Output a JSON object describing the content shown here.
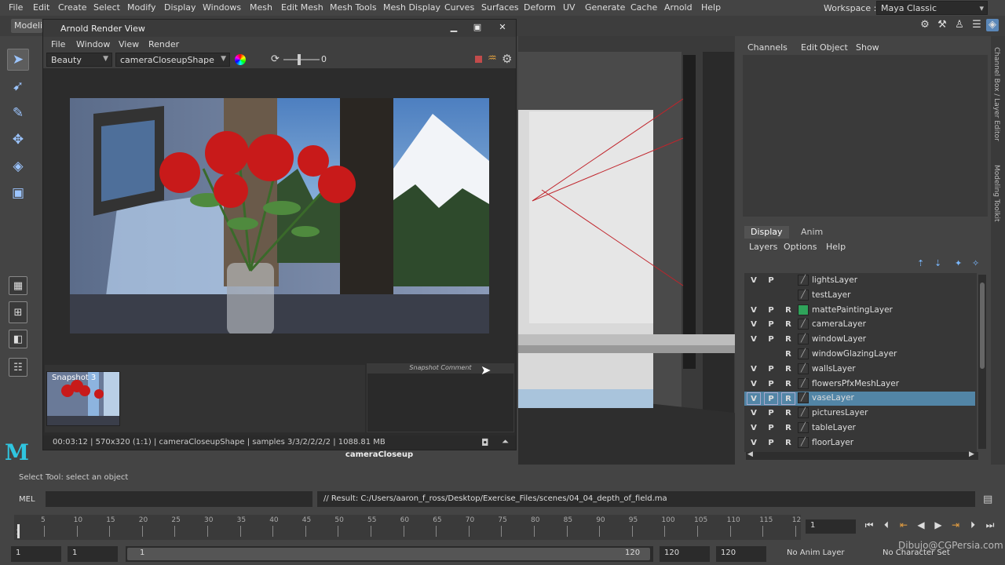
{
  "menubar": {
    "items": [
      "File",
      "Edit",
      "Create",
      "Select",
      "Modify",
      "Display",
      "Windows",
      "Mesh",
      "Edit Mesh",
      "Mesh Tools",
      "Mesh Display",
      "Curves",
      "Surfaces",
      "Deform",
      "UV",
      "Generate",
      "Cache",
      "Arnold",
      "Help"
    ],
    "workspace_label": "Workspace :",
    "workspace_value": "Maya Classic"
  },
  "shelf": {
    "tab": "Modeling"
  },
  "render_view": {
    "title": "Arnold Render View",
    "menu": [
      "File",
      "Window",
      "View",
      "Render"
    ],
    "aov": "Beauty",
    "camera": "cameraCloseupShape",
    "exposure": "0",
    "snapshot_label": "Snapshot 3",
    "snapshot_comment": "Snapshot Comment",
    "status": "00:03:12 | 570x320 (1:1) | cameraCloseupShape  | samples 3/3/2/2/2/2 | 1088.81 MB"
  },
  "viewport": {
    "camera_label": "cameraCloseup"
  },
  "channel_box": {
    "menu": [
      "Channels",
      "Edit",
      "Object",
      "Show"
    ]
  },
  "layer_editor": {
    "tabs": [
      "Display",
      "Anim"
    ],
    "menu": [
      "Layers",
      "Options",
      "Help"
    ],
    "layers": [
      {
        "name": "lightsLayer",
        "v": "V",
        "p": "P",
        "r": ""
      },
      {
        "name": "testLayer",
        "v": "",
        "p": "",
        "r": ""
      },
      {
        "name": "mattePaintingLayer",
        "v": "V",
        "p": "P",
        "r": "R"
      },
      {
        "name": "cameraLayer",
        "v": "V",
        "p": "P",
        "r": "R"
      },
      {
        "name": "windowLayer",
        "v": "V",
        "p": "P",
        "r": "R"
      },
      {
        "name": "windowGlazingLayer",
        "v": "",
        "p": "",
        "r": "R"
      },
      {
        "name": "wallsLayer",
        "v": "V",
        "p": "P",
        "r": "R"
      },
      {
        "name": "flowersPfxMeshLayer",
        "v": "V",
        "p": "P",
        "r": "R"
      },
      {
        "name": "vaseLayer",
        "v": "V",
        "p": "P",
        "r": "R"
      },
      {
        "name": "picturesLayer",
        "v": "V",
        "p": "P",
        "r": "R"
      },
      {
        "name": "tableLayer",
        "v": "V",
        "p": "P",
        "r": "R"
      },
      {
        "name": "floorLayer",
        "v": "V",
        "p": "P",
        "r": "R"
      }
    ],
    "selected_layer": "vaseLayer",
    "colors": {
      "selected_row": "#5285a6",
      "matte_swatch": "#2fa35a"
    }
  },
  "side_tabs": [
    "Channel Box / Layer Editor",
    "Modeling Toolkit"
  ],
  "helpline": "Select Tool: select an object",
  "command_line": {
    "label": "MEL",
    "result": "// Result: C:/Users/aaron_f_ross/Desktop/Exercise_Files/scenes/04_04_depth_of_field.ma"
  },
  "timeline": {
    "ticks": [
      "5",
      "10",
      "15",
      "20",
      "25",
      "30",
      "35",
      "40",
      "45",
      "50",
      "55",
      "60",
      "65",
      "70",
      "75",
      "80",
      "85",
      "90",
      "95",
      "100",
      "105",
      "110",
      "115",
      "12"
    ],
    "first_tick": "1",
    "current_frame": "1"
  },
  "range": {
    "start": "1",
    "playback_start": "1",
    "slider_start": "1",
    "slider_end": "120",
    "playback_end": "120",
    "end": "120",
    "anim_layer": "No Anim Layer",
    "char_set": "No Character Set"
  },
  "watermark": "Dibujo@CGPersia.com"
}
